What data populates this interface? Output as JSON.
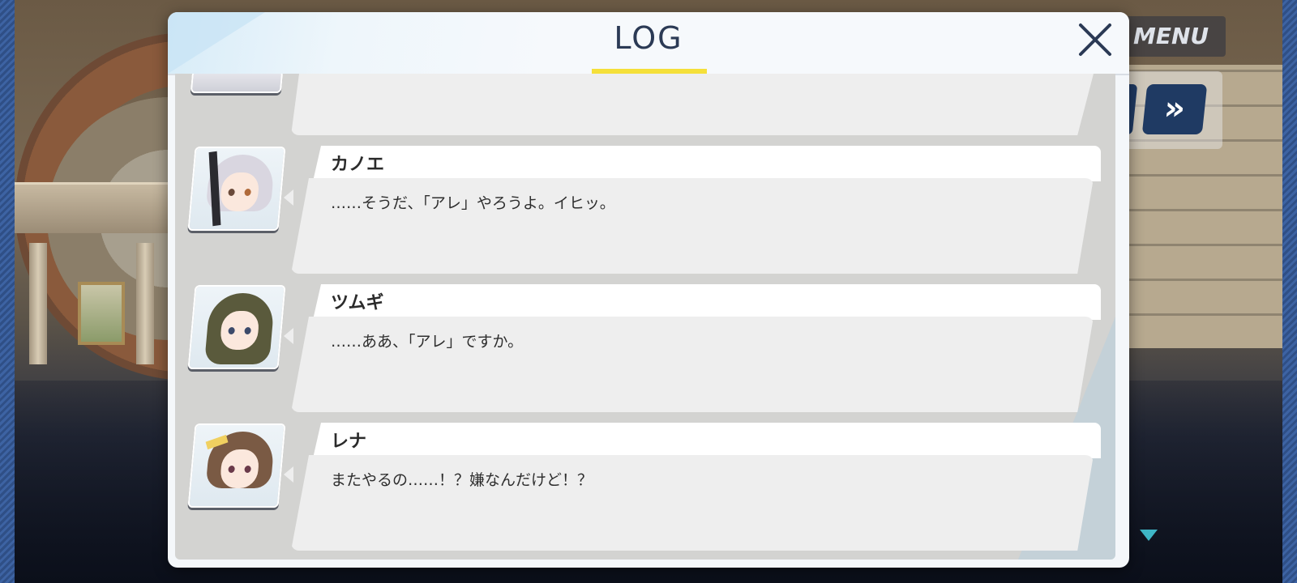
{
  "header": {
    "title": "LOG",
    "close_label": "×"
  },
  "controls": {
    "menu_label": "MENU",
    "skip_label": "»"
  },
  "log": {
    "entries": [
      {
        "speaker": "カノエ",
        "text": "……そうだ、「アレ」やろうよ。イヒッ。",
        "avatar_icon": "kanoe-portrait",
        "hair_color": "#d9d6e0"
      },
      {
        "speaker": "ツムギ",
        "text": "……ああ、「アレ」ですか。",
        "avatar_icon": "tsumugi-portrait",
        "hair_color": "#5a5a3c"
      },
      {
        "speaker": "レナ",
        "text": "またやるの……！？嫌なんだけど！？",
        "avatar_icon": "rena-portrait",
        "hair_color": "#7a5a44"
      }
    ]
  },
  "colors": {
    "accent_underline": "#f5e03a",
    "title_color": "#2b3a55",
    "skip_button": "#1f3a63",
    "next_indicator": "#3eb6c6"
  }
}
